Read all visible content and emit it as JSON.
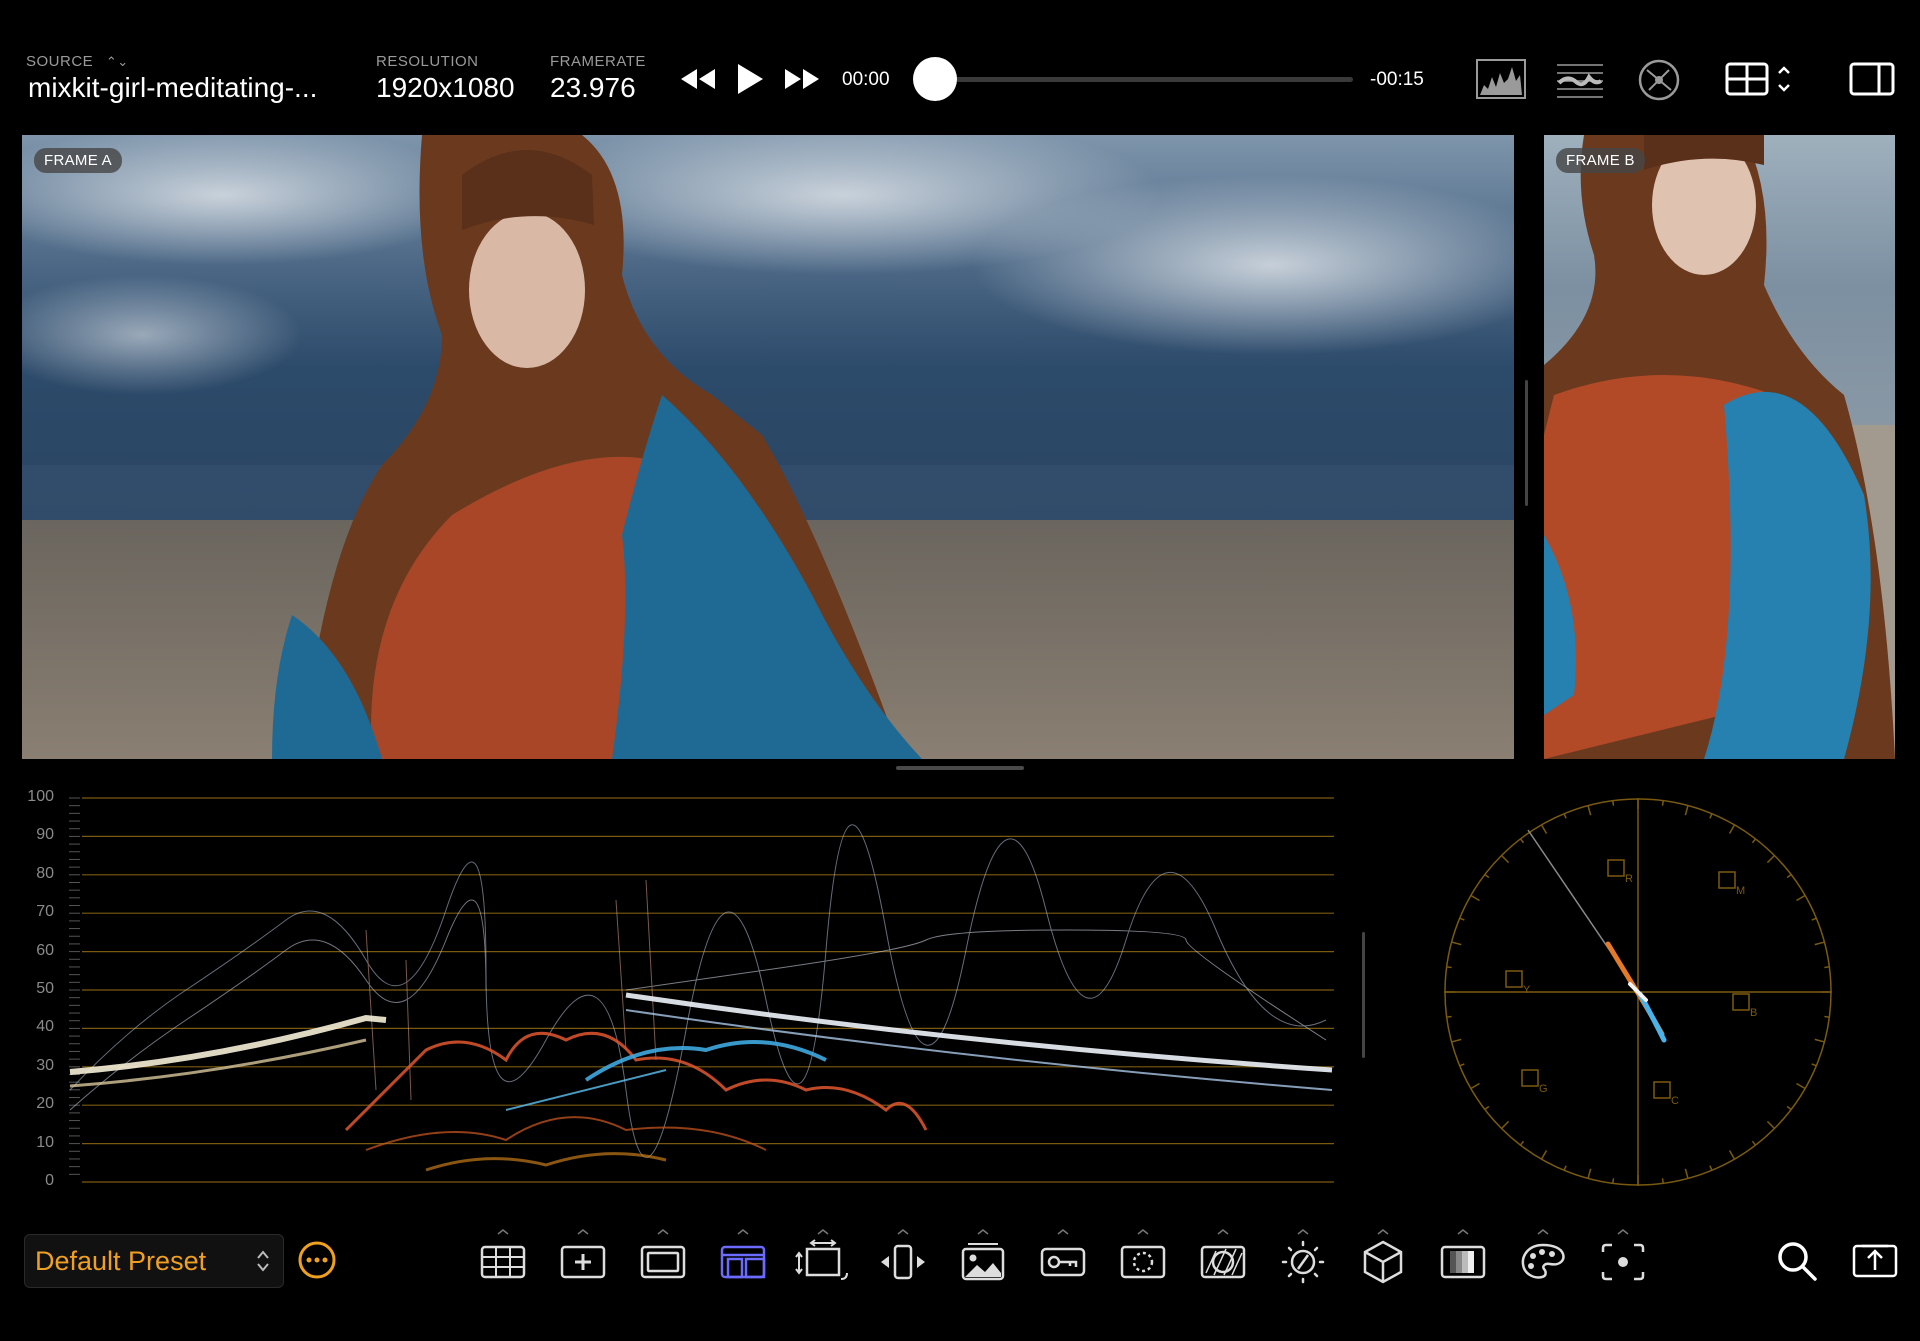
{
  "header": {
    "source_label": "SOURCE",
    "source_value": "mixkit-girl-meditating-...",
    "resolution_label": "RESOLUTION",
    "resolution_value": "1920x1080",
    "framerate_label": "FRAMERATE",
    "framerate_value": "23.976",
    "time_current": "00:00",
    "time_remaining": "-00:15",
    "playhead_progress": 0.0
  },
  "viewer": {
    "frame_a_label": "FRAME A",
    "frame_b_label": "FRAME B"
  },
  "waveform": {
    "scale": [
      "100",
      "90",
      "80",
      "70",
      "60",
      "50",
      "40",
      "30",
      "20",
      "10",
      "0"
    ]
  },
  "vectorscope": {
    "targets": [
      "R",
      "M",
      "Y",
      "B",
      "G",
      "C"
    ]
  },
  "footer": {
    "preset_label": "Default Preset",
    "tools": [
      "grid-icon",
      "add-frame-icon",
      "frame-icon",
      "split-layout-icon",
      "transform-icon",
      "flip-icon",
      "image-icon",
      "key-icon",
      "mask-icon",
      "overlay-icon",
      "exposure-icon",
      "cube-lut-icon",
      "gradient-icon",
      "palette-icon",
      "focus-icon"
    ]
  },
  "colors": {
    "accent_orange": "#f0a020",
    "active_blue": "#6b6bff",
    "scope_grid": "#7a5a10"
  }
}
